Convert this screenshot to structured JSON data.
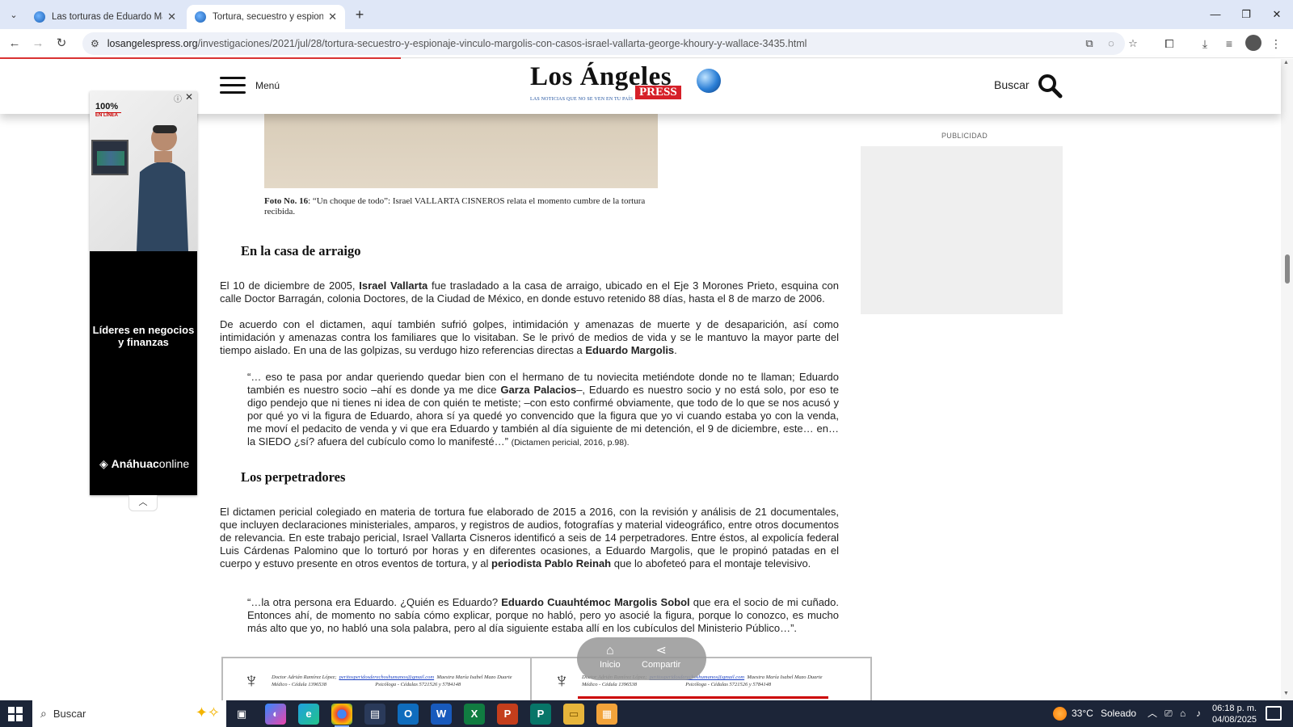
{
  "browser": {
    "tabs": [
      {
        "title": "Las torturas de Eduardo Margolis",
        "active": false
      },
      {
        "title": "Tortura, secuestro y espionaje, vínculo",
        "active": true
      }
    ],
    "url_host": "losangelespress.org",
    "url_path": "/investigaciones/2021/jul/28/tortura-secuestro-y-espionaje-vinculo-margolis-con-casos-israel-vallarta-george-khoury-y-wallace-3435.html",
    "accent_color": "#d33333"
  },
  "site": {
    "menu_label": "Menú",
    "logo_text": "Los Ángeles",
    "logo_press": "PRESS",
    "logo_tagline": "LAS NOTICIAS QUE NO SE VEN EN TU PAÍS",
    "search_label": "Buscar"
  },
  "article": {
    "caption_bold": "Foto No. 16",
    "caption_text": ": “Un choque de todo”: Israel VALLARTA CISNEROS relata el momento cumbre de la tortura recibida.",
    "section1_title": "En la casa de arraigo",
    "p1_a": "El 10 de diciembre de 2005, ",
    "p1_b": "Israel Vallarta",
    "p1_c": " fue trasladado a la casa de arraigo, ubicado en el Eje 3 Morones Prieto, esquina con calle Doctor Barragán, colonia Doctores, de la Ciudad de México, en donde estuvo retenido 88 días, hasta el 8 de marzo de 2006.",
    "p2_a": "De acuerdo con el dictamen, aquí también sufrió golpes, intimidación y amenazas de muerte y de desaparición, así como intimidación y amenazas contra los familiares que lo visitaban. Se le privó de medios de vida y se le mantuvo la mayor parte del tiempo aislado. En una de las golpizas, su verdugo hizo referencias directas a ",
    "p2_b": "Eduardo Margolis",
    "p2_c": ".",
    "q1_a": "“… eso te pasa por andar queriendo quedar bien con el hermano de tu noviecita metiéndote donde no te llaman; Eduardo también es nuestro socio –ahí es donde ya me dice ",
    "q1_b": "Garza Palacios",
    "q1_c": "–, Eduardo es nuestro socio y no está solo, por eso te digo pendejo que ni tienes ni idea de con quién te metiste; –con esto confirmé obviamente, que todo de lo que se nos acusó y por qué yo vi la figura de Eduardo, ahora sí ya quedé yo convencido que la figura que yo vi cuando estaba yo con la venda, me moví el pedacito de venda y vi que era Eduardo y también al día siguiente de mi detención, el 9 de diciembre, este… en… la SIEDO ¿sí? afuera del cubículo como lo manifesté…” ",
    "q1_cite": "(Dictamen pericial, 2016, p.98).",
    "section2_title": "Los perpetradores",
    "p3_a": "El dictamen pericial colegiado en materia de tortura fue elaborado de 2015 a 2016, con la revisión y análisis de 21 documentales, que incluyen declaraciones ministeriales, amparos, y registros de audios, fotografías y material videográfico, entre otros documentos de relevancia. En este trabajo pericial, Israel Vallarta Cisneros identificó a seis de 14 perpetradores. Entre éstos, al expolicía federal Luis Cárdenas Palomino que lo torturó por horas y en diferentes ocasiones, a Eduardo Margolis, que le propinó patadas en el cuerpo y estuvo presente en otros eventos de tortura, y al ",
    "p3_b": "periodista Pablo Reinah",
    "p3_c": " que lo abofeteó para el montaje televisivo.",
    "q2_a": "“…la otra persona era Eduardo. ¿Quién es Eduardo? ",
    "q2_b": "Eduardo Cuauhtémoc Margolis Sobol",
    "q2_c": " que era el socio de mi cuñado. Entonces ahí, de momento no sabía cómo explicar, porque no habló, pero yo asocié la figura, porque lo conozco, es mucho más alto que yo, no habló una sola palabra, pero al día siguiente estaba allí en los cubículos del Ministerio Público…”.",
    "doc_names": "Doctor Adrián Ramírez López",
    "doc_email": "peritosperidosderechoshumanos@gmail.com",
    "doc_second": "Maestra María Isabel Mazo Duarte",
    "doc_role1": "Médico - Cédula 1396538",
    "doc_role2": "Psicóloga - Cédulas 5721526 y 5784148"
  },
  "ad": {
    "badge": "100%",
    "badge_sub": "EN LÍNEA",
    "headline": "Líderes en negocios y finanzas",
    "brand_a": "Anáhuac",
    "brand_b": "online"
  },
  "publicidad_label": "PUBLICIDAD",
  "float_bar": {
    "home": "Inicio",
    "share": "Compartir"
  },
  "taskbar": {
    "search_placeholder": "Buscar",
    "weather": "33°C",
    "weather_desc": "Soleado",
    "time": "06:18 p. m.",
    "date": "04/08/2025"
  }
}
